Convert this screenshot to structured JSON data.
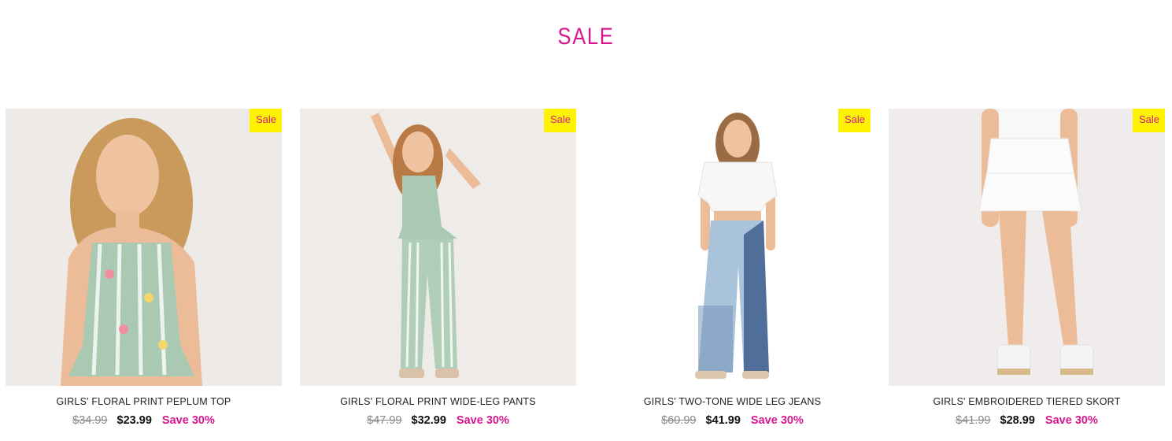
{
  "heading": "SALE",
  "colors": {
    "accent": "#d6178e",
    "badge_bg": "#fff200"
  },
  "products": [
    {
      "badge": "Sale",
      "title": "GIRLS' FLORAL PRINT PEPLUM TOP",
      "old_price": "$34.99",
      "new_price": "$23.99",
      "save": "Save 30%"
    },
    {
      "badge": "Sale",
      "title": "GIRLS' FLORAL PRINT WIDE-LEG PANTS",
      "old_price": "$47.99",
      "new_price": "$32.99",
      "save": "Save 30%"
    },
    {
      "badge": "Sale",
      "title": "GIRLS' TWO-TONE WIDE LEG JEANS",
      "old_price": "$60.99",
      "new_price": "$41.99",
      "save": "Save 30%"
    },
    {
      "badge": "Sale",
      "title": "GIRLS' EMBROIDERED TIERED SKORT",
      "old_price": "$41.99",
      "new_price": "$28.99",
      "save": "Save 30%"
    }
  ]
}
